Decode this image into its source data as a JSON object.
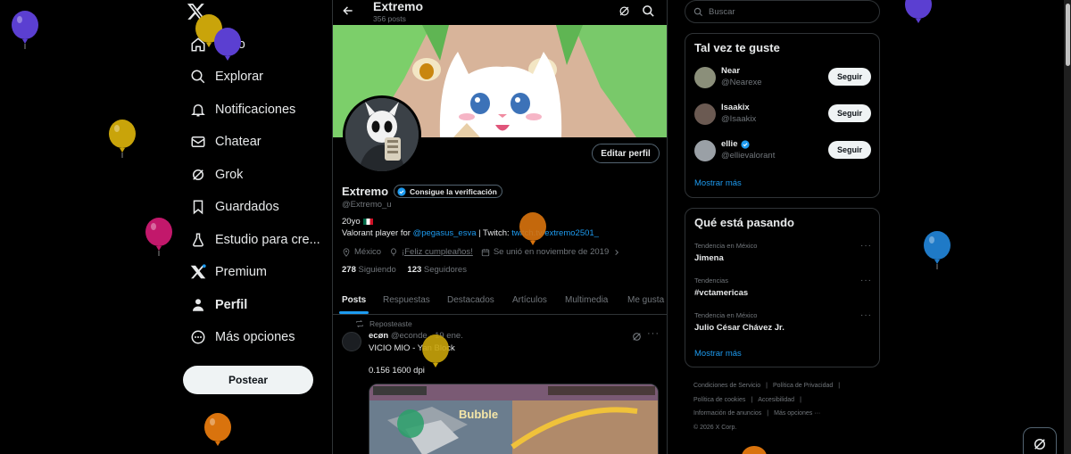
{
  "nav": {
    "items": [
      {
        "label": "Inicio",
        "icon": "home-icon"
      },
      {
        "label": "Explorar",
        "icon": "search-icon"
      },
      {
        "label": "Notificaciones",
        "icon": "bell-icon"
      },
      {
        "label": "Chatear",
        "icon": "mail-icon"
      },
      {
        "label": "Grok",
        "icon": "grok-icon"
      },
      {
        "label": "Guardados",
        "icon": "bookmark-icon"
      },
      {
        "label": "Estudio para cre...",
        "icon": "flask-icon"
      },
      {
        "label": "Premium",
        "icon": "x-logo-icon"
      },
      {
        "label": "Perfil",
        "icon": "person-icon"
      },
      {
        "label": "Más opciones",
        "icon": "more-circle-icon"
      }
    ],
    "post_label": "Postear"
  },
  "profile": {
    "title": "Extremo",
    "posts_count": "356 posts",
    "name": "Extremo",
    "verify_label": "Consigue la verificación",
    "handle": "@Extremo_u",
    "bio_line1": "20yo",
    "bio_prefix": "Valorant player for ",
    "bio_mention": "@pegasus_esva",
    "bio_mid": " | Twitch: ",
    "bio_link": "twitch.tv/extremo2501_",
    "location": "México",
    "birthday": "¡Feliz cumpleaños!",
    "joined": "Se unió en noviembre de 2019",
    "following_count": "278",
    "following_label": "Siguiendo",
    "followers_count": "123",
    "followers_label": "Seguidores",
    "edit_label": "Editar perfil"
  },
  "tabs": [
    "Posts",
    "Respuestas",
    "Destacados",
    "Artículos",
    "Multimedia",
    "Me gusta"
  ],
  "post": {
    "repost_label": "Reposteaste",
    "author": "ecøn",
    "author_handle": "@econde",
    "date": "19 ene.",
    "text1": "VICIO MIO - Yan Block",
    "text2": "0.156 1600 dpi",
    "media_text": "Bubble"
  },
  "search": {
    "placeholder": "Buscar"
  },
  "who_to_follow": {
    "title": "Tal vez te guste",
    "users": [
      {
        "name": "Near",
        "handle": "@Nearexe",
        "follow": "Seguir",
        "color": "#8b8f7a",
        "verified": false
      },
      {
        "name": "Isaakix",
        "handle": "@Isaakix",
        "follow": "Seguir",
        "color": "#6b5a52",
        "verified": false
      },
      {
        "name": "ellie",
        "handle": "@ellievalorant",
        "follow": "Seguir",
        "color": "#9aa0a6",
        "verified": true
      }
    ],
    "more": "Mostrar más"
  },
  "trends": {
    "title": "Qué está pasando",
    "items": [
      {
        "context": "Tendencia en México",
        "title": "Jimena"
      },
      {
        "context": "Tendencias",
        "title": "#vctamericas"
      },
      {
        "context": "Tendencia en México",
        "title": "Julio César Chávez Jr."
      }
    ],
    "more": "Mostrar más"
  },
  "footer": {
    "links": [
      "Condiciones de Servicio",
      "Política de Privacidad",
      "Política de cookies",
      "Accesibilidad",
      "Información de anuncios",
      "Más opciones ···"
    ],
    "copyright": "© 2026 X Corp."
  },
  "balloon_colors": [
    "#5b3fd1",
    "#c9a40a",
    "#c2186b",
    "#d9730d",
    "#1f7ac7"
  ],
  "accent": "#1d9bf0"
}
